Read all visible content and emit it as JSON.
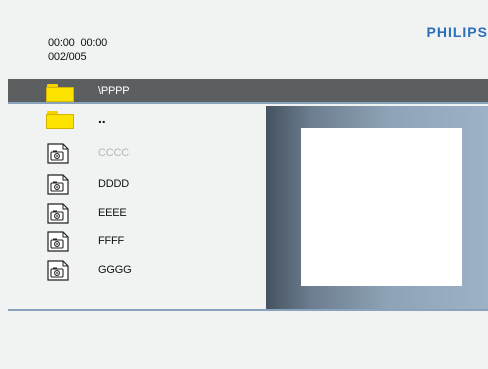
{
  "header": {
    "time_elapsed": "00:00",
    "time_total": "00:00",
    "counter": "002/005",
    "brand": "PHILIPS"
  },
  "path_bar": {
    "path": "\\PPPP",
    "icon": "folder-icon"
  },
  "file_list": [
    {
      "label": "..",
      "icon": "folder-icon",
      "type": "parent",
      "dimmed": false
    },
    {
      "label": "CCCC",
      "icon": "photo-file-icon",
      "type": "file",
      "dimmed": true
    },
    {
      "label": "DDDD",
      "icon": "photo-file-icon",
      "type": "file",
      "dimmed": false
    },
    {
      "label": "EEEE",
      "icon": "photo-file-icon",
      "type": "file",
      "dimmed": false
    },
    {
      "label": "FFFF",
      "icon": "photo-file-icon",
      "type": "file",
      "dimmed": false
    },
    {
      "label": "GGGG",
      "icon": "photo-file-icon",
      "type": "file",
      "dimmed": false
    }
  ],
  "colors": {
    "brand": "#2a6fb8",
    "path_bar": "#5b5f60",
    "folder": "#fde400",
    "accent_line": "#8aa3bd"
  }
}
